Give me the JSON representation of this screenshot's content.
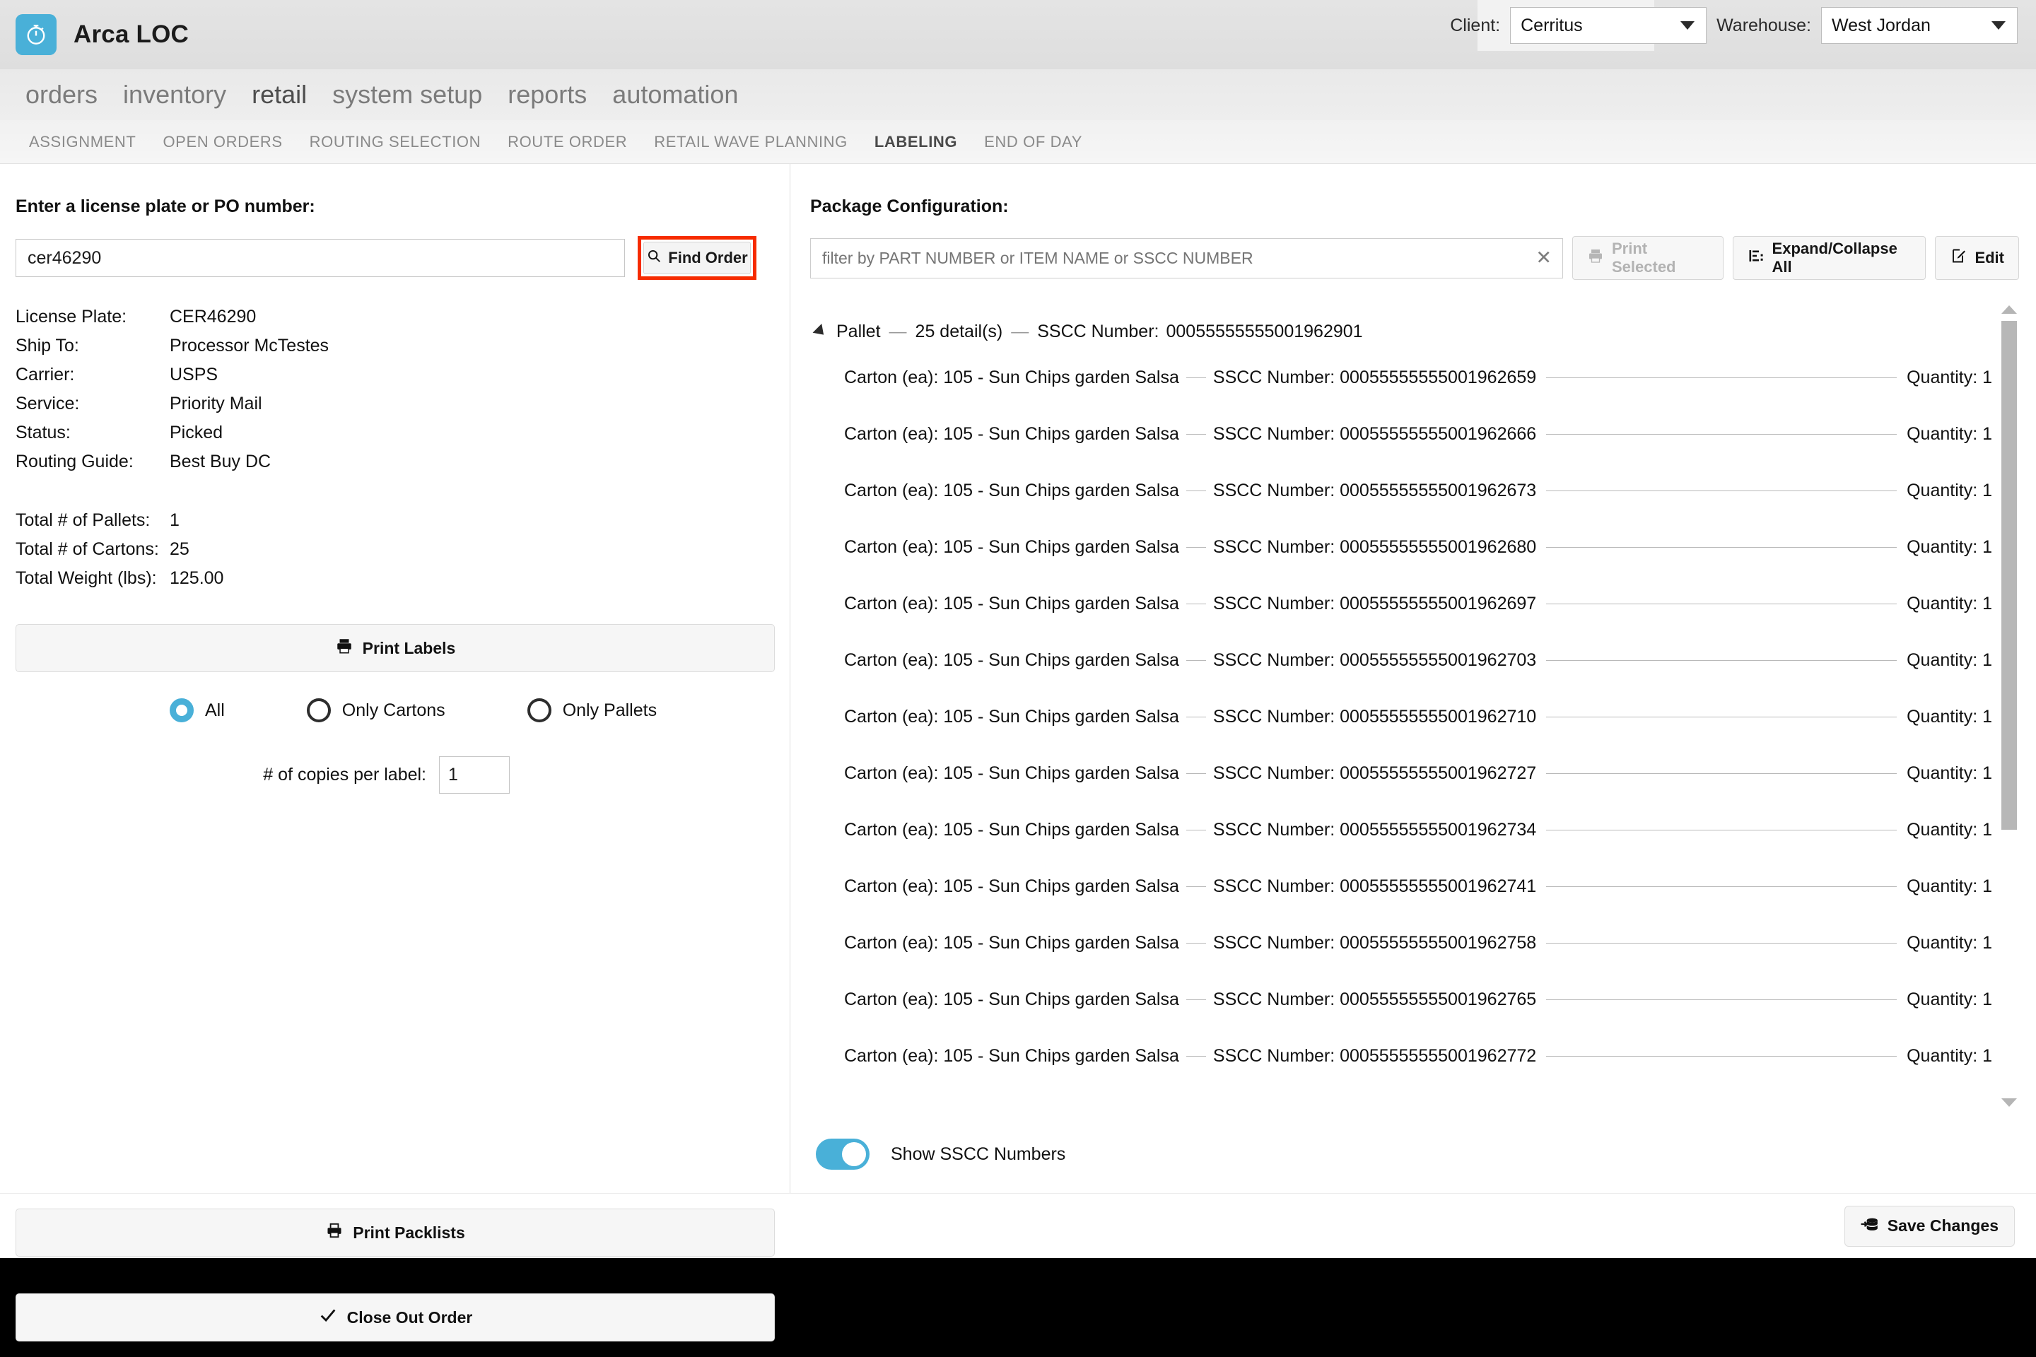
{
  "window": {
    "app_title": "Arca LOC",
    "logo_icon": "stopwatch-icon",
    "minimize_icon": "minimize-icon",
    "maximize_icon": "maximize-icon",
    "close_icon": "close-icon"
  },
  "header": {
    "client_label": "Client:",
    "client_value": "Cerritus",
    "warehouse_label": "Warehouse:",
    "warehouse_value": "West Jordan"
  },
  "mainnav": [
    {
      "label": "orders",
      "active": false
    },
    {
      "label": "inventory",
      "active": false
    },
    {
      "label": "retail",
      "active": true
    },
    {
      "label": "system setup",
      "active": false
    },
    {
      "label": "reports",
      "active": false
    },
    {
      "label": "automation",
      "active": false
    }
  ],
  "subnav": [
    {
      "label": "ASSIGNMENT",
      "active": false
    },
    {
      "label": "OPEN ORDERS",
      "active": false
    },
    {
      "label": "ROUTING SELECTION",
      "active": false
    },
    {
      "label": "ROUTE ORDER",
      "active": false
    },
    {
      "label": "RETAIL WAVE PLANNING",
      "active": false
    },
    {
      "label": "LABELING",
      "active": true
    },
    {
      "label": "END OF DAY",
      "active": false
    }
  ],
  "left": {
    "prompt": "Enter a license plate or PO number:",
    "lp_value": "cer46290",
    "lp_placeholder": "",
    "find_order_label": "Find Order",
    "find_order_icon": "search-icon",
    "details": [
      {
        "key": "License Plate:",
        "value": "CER46290"
      },
      {
        "key": "Ship To:",
        "value": "Processor McTestes"
      },
      {
        "key": "Carrier:",
        "value": "USPS"
      },
      {
        "key": "Service:",
        "value": "Priority Mail"
      },
      {
        "key": "Status:",
        "value": "Picked"
      },
      {
        "key": "Routing Guide:",
        "value": "Best Buy DC"
      }
    ],
    "totals": [
      {
        "key": "Total # of Pallets:",
        "value": "1"
      },
      {
        "key": "Total # of Cartons:",
        "value": "25"
      },
      {
        "key": "Total Weight (lbs):",
        "value": "125.00"
      }
    ],
    "print_labels_label": "Print Labels",
    "print_labels_icon": "printer-icon",
    "radios": [
      {
        "label": "All",
        "selected": true
      },
      {
        "label": "Only Cartons",
        "selected": false
      },
      {
        "label": "Only Pallets",
        "selected": false
      }
    ],
    "copies_label": "# of copies per label:",
    "copies_value": "1",
    "print_packlists_label": "Print Packlists",
    "print_packlists_icon": "printer-icon",
    "close_out_label": "Close Out Order",
    "close_out_icon": "check-icon"
  },
  "right": {
    "title": "Package Configuration:",
    "filter_value": "",
    "filter_placeholder": "filter by PART NUMBER or ITEM NAME or SSCC NUMBER",
    "filter_clear_icon": "close-icon",
    "print_selected_label": "Print Selected",
    "print_selected_icon": "printer-icon",
    "print_selected_disabled": true,
    "expand_collapse_label": "Expand/Collapse All",
    "expand_collapse_icon": "expand-collapse-icon",
    "edit_label": "Edit",
    "edit_icon": "edit-icon",
    "pallet": {
      "label": "Pallet",
      "detail_count": "25 detail(s)",
      "sscc_label": "SSCC Number:",
      "sscc": "00055555555001962901",
      "expanded": true,
      "caret_icon": "caret-down-icon"
    },
    "qty_label": "Quantity:",
    "sscc_label": "SSCC Number:",
    "cartons": [
      {
        "desc": "Carton (ea): 105  -  Sun Chips garden Salsa",
        "sscc": "00055555555001962659",
        "qty": "1"
      },
      {
        "desc": "Carton (ea): 105  -  Sun Chips garden Salsa",
        "sscc": "00055555555001962666",
        "qty": "1"
      },
      {
        "desc": "Carton (ea): 105  -  Sun Chips garden Salsa",
        "sscc": "00055555555001962673",
        "qty": "1"
      },
      {
        "desc": "Carton (ea): 105  -  Sun Chips garden Salsa",
        "sscc": "00055555555001962680",
        "qty": "1"
      },
      {
        "desc": "Carton (ea): 105  -  Sun Chips garden Salsa",
        "sscc": "00055555555001962697",
        "qty": "1"
      },
      {
        "desc": "Carton (ea): 105  -  Sun Chips garden Salsa",
        "sscc": "00055555555001962703",
        "qty": "1"
      },
      {
        "desc": "Carton (ea): 105  -  Sun Chips garden Salsa",
        "sscc": "00055555555001962710",
        "qty": "1"
      },
      {
        "desc": "Carton (ea): 105  -  Sun Chips garden Salsa",
        "sscc": "00055555555001962727",
        "qty": "1"
      },
      {
        "desc": "Carton (ea): 105  -  Sun Chips garden Salsa",
        "sscc": "00055555555001962734",
        "qty": "1"
      },
      {
        "desc": "Carton (ea): 105  -  Sun Chips garden Salsa",
        "sscc": "00055555555001962741",
        "qty": "1"
      },
      {
        "desc": "Carton (ea): 105  -  Sun Chips garden Salsa",
        "sscc": "00055555555001962758",
        "qty": "1"
      },
      {
        "desc": "Carton (ea): 105  -  Sun Chips garden Salsa",
        "sscc": "00055555555001962765",
        "qty": "1"
      },
      {
        "desc": "Carton (ea): 105  -  Sun Chips garden Salsa",
        "sscc": "00055555555001962772",
        "qty": "1"
      }
    ],
    "toggle_label": "Show SSCC Numbers",
    "toggle_on": true,
    "save_label": "Save Changes",
    "save_icon": "save-database-icon"
  },
  "colors": {
    "accent": "#49b0d8",
    "highlight": "#f62b00"
  }
}
